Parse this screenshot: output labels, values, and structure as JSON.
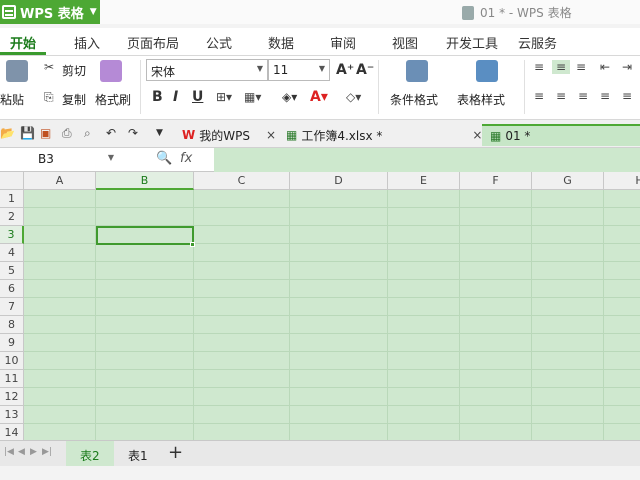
{
  "app": {
    "name": "WPS 表格",
    "window_title": "01 * - WPS 表格"
  },
  "menu": {
    "tabs": [
      "开始",
      "插入",
      "页面布局",
      "公式",
      "数据",
      "审阅",
      "视图",
      "开发工具",
      "云服务"
    ]
  },
  "ribbon": {
    "paste": "粘贴",
    "cut": "剪切",
    "copy": "复制",
    "format_painter": "格式刷",
    "font_name": "宋体",
    "font_size": "11",
    "bold": "B",
    "italic": "I",
    "underline": "U",
    "cond_format": "条件格式",
    "table_style": "表格样式"
  },
  "doc_tabs": [
    {
      "label": "我的WPS"
    },
    {
      "label": "工作簿4.xlsx *"
    },
    {
      "label": "01 *"
    }
  ],
  "formula_bar": {
    "name_box": "B3",
    "fx": "fx",
    "formula": ""
  },
  "grid": {
    "columns": [
      "A",
      "B",
      "C",
      "D",
      "E",
      "F",
      "G",
      "H"
    ],
    "rows": [
      "1",
      "2",
      "3",
      "4",
      "5",
      "6",
      "7",
      "8",
      "9",
      "10",
      "11",
      "12",
      "13",
      "14"
    ],
    "selected_cell": "B3"
  },
  "sheets": {
    "tabs": [
      "表2",
      "表1"
    ],
    "active": "表2",
    "add": "+"
  },
  "colors": {
    "accent": "#4da834",
    "cell_bg": "#cfe8cf"
  }
}
